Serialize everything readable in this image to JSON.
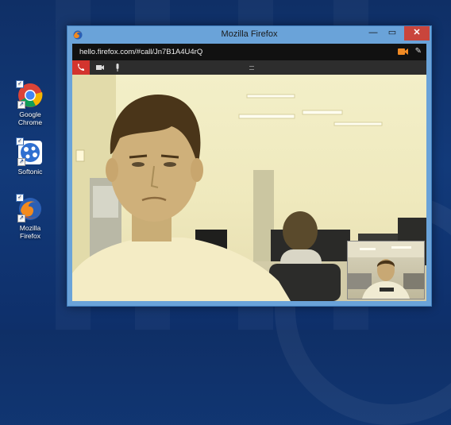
{
  "desktop": {
    "icons": [
      {
        "label_line1": "Google",
        "label_line2": "Chrome",
        "icon": "chrome-icon"
      },
      {
        "label_line1": "Softonic",
        "label_line2": "",
        "icon": "softonic-icon"
      },
      {
        "label_line1": "Mozilla",
        "label_line2": "Firefox",
        "icon": "firefox-icon"
      }
    ]
  },
  "window": {
    "title": "Mozilla Firefox",
    "minimize_glyph": "—",
    "maximize_glyph": "▭",
    "close_glyph": "✕",
    "url": "hello.firefox.com/#call/Jn7B1A4U4rQ"
  },
  "colors": {
    "titlebar": "#6aa3d9",
    "hangup": "#d3342e",
    "camera_accent": "#f08a24",
    "close": "#c9453c"
  }
}
